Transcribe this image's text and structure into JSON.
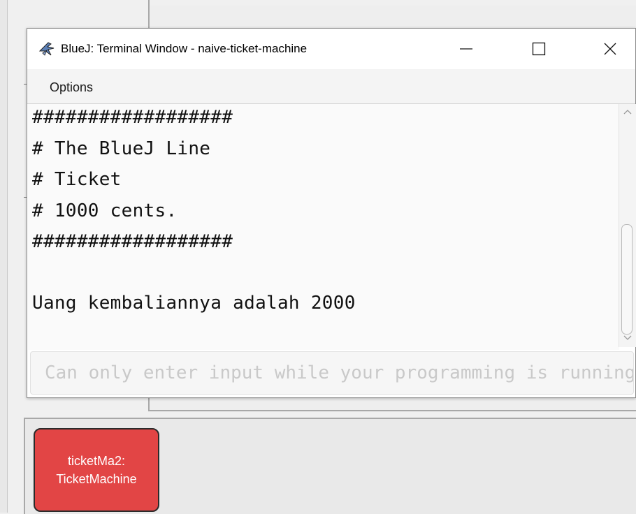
{
  "terminal": {
    "title": "BlueJ: Terminal Window - naive-ticket-machine",
    "app_icon": "bluej-bird-icon",
    "controls": {
      "minimize": "minimize-icon",
      "maximize": "maximize-icon",
      "close": "close-icon"
    }
  },
  "menu": {
    "options_label": "Options"
  },
  "output": {
    "lines": [
      "##################",
      "# The BlueJ Line",
      "# Ticket",
      "# 1000 cents.",
      "##################",
      "",
      "Uang kembaliannya adalah 2000"
    ]
  },
  "input": {
    "placeholder": "Can only enter input while your programming is running"
  },
  "object_bench": {
    "objects": [
      {
        "name": "ticketMa2:",
        "type": "TicketMachine",
        "color": "#e24545"
      }
    ]
  }
}
